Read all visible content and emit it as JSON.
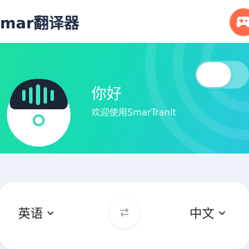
{
  "header": {
    "title": "mar翻译器",
    "app_icon": "game-controller-icon",
    "app_icon_color": "#ff6b4a"
  },
  "banner": {
    "greeting": "你好",
    "subtitle": "欢迎使用SmarTranIt",
    "gradient_start": "#1ce0a0",
    "gradient_end": "#2ac8df",
    "mascot": "robot-mascot-icon",
    "toggle_state": "off"
  },
  "languages": {
    "source": "英语",
    "target": "中文",
    "swap_icon": "swap-arrows-icon",
    "dropdown_icon": "chevron-down-icon"
  }
}
